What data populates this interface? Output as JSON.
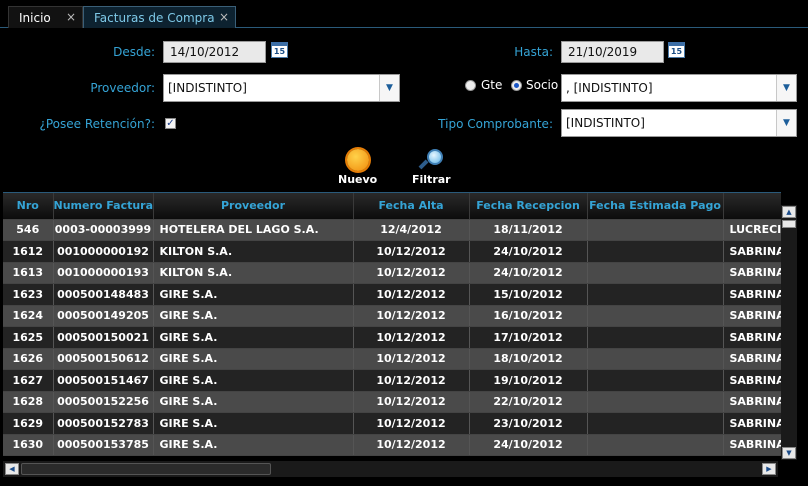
{
  "tabs": [
    {
      "label": "Inicio",
      "close": "×"
    },
    {
      "label": "Facturas de Compra",
      "close": "×"
    }
  ],
  "form": {
    "desde_label": "Desde:",
    "desde_value": "14/10/2012",
    "hasta_label": "Hasta:",
    "hasta_value": "21/10/2019",
    "calendar_glyph": "15",
    "proveedor_label": "Proveedor:",
    "proveedor_value": "[INDISTINTO]",
    "gte_label": "Gte",
    "socio_label": "Socio",
    "selected_radio": "Socio",
    "socio_value": ", [INDISTINTO]",
    "retencion_label": "¿Posee Retención?:",
    "retencion_checked": true,
    "tipo_label": "Tipo Comprobante:",
    "tipo_value": "[INDISTINTO]",
    "nuevo_label": "Nuevo",
    "filtrar_label": "Filtrar"
  },
  "grid": {
    "columns": [
      "Nro",
      "Numero Factura",
      "Proveedor",
      "Fecha Alta",
      "Fecha Recepcion",
      "Fecha Estimada Pago",
      ""
    ],
    "rows": [
      [
        "546",
        "0003-00003999",
        "HOTELERA DEL LAGO S.A.",
        "12/4/2012",
        "18/11/2012",
        "",
        "LUCRECIA"
      ],
      [
        "1612",
        "001000000192",
        "KILTON S.A.",
        "10/12/2012",
        "24/10/2012",
        "",
        "SABRINA I"
      ],
      [
        "1613",
        "001000000193",
        "KILTON S.A.",
        "10/12/2012",
        "24/10/2012",
        "",
        "SABRINA I"
      ],
      [
        "1623",
        "000500148483",
        "GIRE S.A.",
        "10/12/2012",
        "15/10/2012",
        "",
        "SABRINA I"
      ],
      [
        "1624",
        "000500149205",
        "GIRE S.A.",
        "10/12/2012",
        "16/10/2012",
        "",
        "SABRINA I"
      ],
      [
        "1625",
        "000500150021",
        "GIRE S.A.",
        "10/12/2012",
        "17/10/2012",
        "",
        "SABRINA I"
      ],
      [
        "1626",
        "000500150612",
        "GIRE S.A.",
        "10/12/2012",
        "18/10/2012",
        "",
        "SABRINA I"
      ],
      [
        "1627",
        "000500151467",
        "GIRE S.A.",
        "10/12/2012",
        "19/10/2012",
        "",
        "SABRINA I"
      ],
      [
        "1628",
        "000500152256",
        "GIRE S.A.",
        "10/12/2012",
        "22/10/2012",
        "",
        "SABRINA I"
      ],
      [
        "1629",
        "000500152783",
        "GIRE S.A.",
        "10/12/2012",
        "23/10/2012",
        "",
        "SABRINA I"
      ],
      [
        "1630",
        "000500153785",
        "GIRE S.A.",
        "10/12/2012",
        "24/10/2012",
        "",
        "SABRINA I"
      ]
    ]
  },
  "colors": {
    "accent": "#35a4d6",
    "background": "#000000",
    "row_odd": "#4a4a4a",
    "row_even": "#232323"
  }
}
